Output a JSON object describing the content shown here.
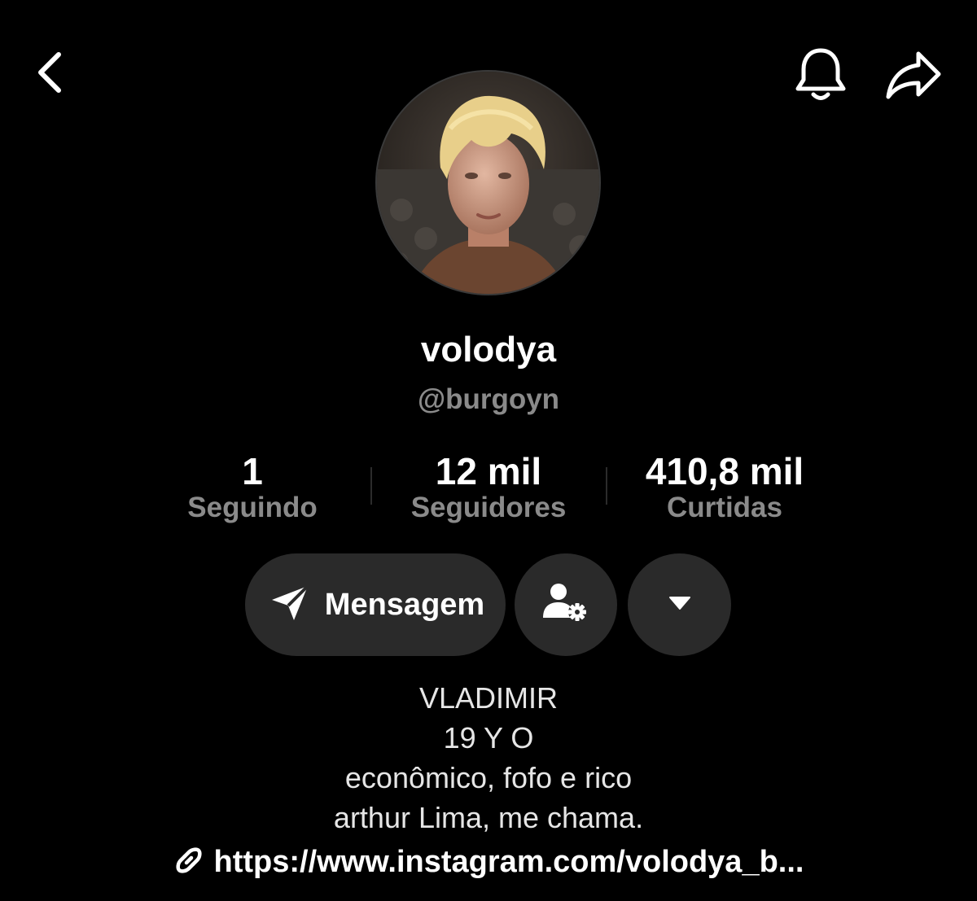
{
  "header": {
    "back_icon": "chevron-left-icon",
    "bell_icon": "bell-icon",
    "share_icon": "share-arrow-icon"
  },
  "profile": {
    "avatar": "profile-photo",
    "display_name": "volodya",
    "handle": "@burgoyn"
  },
  "stats": [
    {
      "value": "1",
      "label": "Seguindo"
    },
    {
      "value": "12 mil",
      "label": "Seguidores"
    },
    {
      "value": "410,8 mil",
      "label": "Curtidas"
    }
  ],
  "actions": {
    "message_label": "Mensagem",
    "message_icon": "paper-plane-icon",
    "friend_icon": "user-settings-icon",
    "more_icon": "caret-down-icon",
    "button_color": "#2a2a2a"
  },
  "bio": {
    "lines": [
      "VLADIMIR",
      "19 Y O",
      "econômico, fofo e rico",
      "arthur Lima, me chama."
    ],
    "link_icon": "link-icon",
    "link_text": "https://www.instagram.com/volodya_b..."
  },
  "colors": {
    "background": "#000000",
    "primary_text": "#ffffff",
    "secondary_text": "#8a8a8a"
  }
}
